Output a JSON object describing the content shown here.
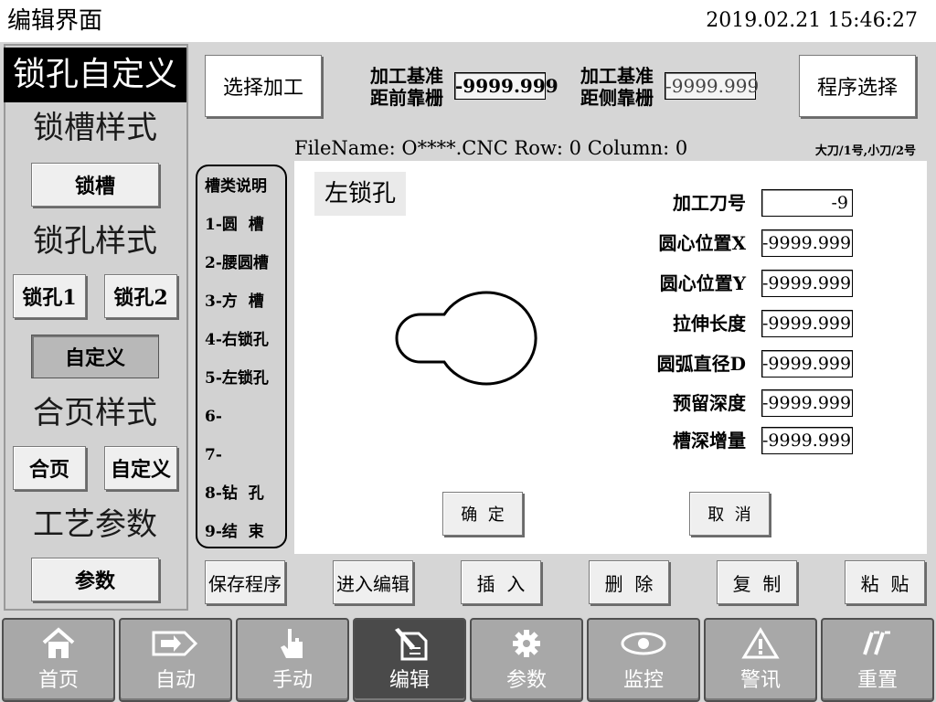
{
  "header": {
    "title": "编辑界面",
    "datetime": "2019.02.21 15:46:27"
  },
  "left": {
    "title": "锁孔自定义",
    "sections": [
      "锁槽样式",
      "锁孔样式",
      "合页样式",
      "工艺参数"
    ],
    "buttons": {
      "slot": "锁槽",
      "lock1": "锁孔1",
      "lock2": "锁孔2",
      "custom1": "自定义",
      "hinge": "合页",
      "custom2": "自定义",
      "params": "参数"
    }
  },
  "top": {
    "select_process": "选择加工",
    "program_select": "程序选择",
    "ref1_label_1": "加工基准",
    "ref1_label_2": "距前靠栅",
    "ref1_value": "-9999.999",
    "ref2_label_1": "加工基准",
    "ref2_label_2": "距侧靠栅",
    "ref2_value": "-9999.999",
    "fileinfo": "FileName: O****.CNC Row: 0 Column: 0",
    "tool_hint": "大刀/1号,小刀/2号"
  },
  "slot_types": [
    "槽类说明",
    "1-圆  槽",
    "2-腰圆槽",
    "3-方  槽",
    "4-右锁孔",
    "5-左锁孔",
    "6-",
    "7-",
    "8-钻  孔",
    "9-结  束"
  ],
  "main": {
    "shape_title": "左锁孔",
    "params": [
      {
        "label": "加工刀号",
        "value": "-9"
      },
      {
        "label": "圆心位置X",
        "value": "-9999.999"
      },
      {
        "label": "圆心位置Y",
        "value": "-9999.999"
      },
      {
        "label": "拉伸长度",
        "value": "-9999.999"
      },
      {
        "label": "圆弧直径D",
        "value": "-9999.999"
      },
      {
        "label": "预留深度",
        "value": "-9999.999"
      },
      {
        "label": "槽深增量",
        "value": "-9999.999"
      }
    ],
    "confirm": "确  定",
    "cancel": "取  消"
  },
  "functions": [
    "保存程序",
    "进入编辑",
    "插  入",
    "删  除",
    "复  制",
    "粘  贴"
  ],
  "nav": [
    {
      "label": "首页",
      "icon": "home-icon"
    },
    {
      "label": "自动",
      "icon": "auto-arrow-icon"
    },
    {
      "label": "手动",
      "icon": "hand-pointer-icon"
    },
    {
      "label": "编辑",
      "icon": "edit-document-icon"
    },
    {
      "label": "参数",
      "icon": "gear-icon"
    },
    {
      "label": "监控",
      "icon": "eye-icon"
    },
    {
      "label": "警讯",
      "icon": "warning-icon"
    },
    {
      "label": "重置",
      "icon": "reset-icon"
    }
  ],
  "colors": {
    "active_nav": "#4a4a4a",
    "nav": "#a8a8a8",
    "panel": "#d2d2d2"
  }
}
